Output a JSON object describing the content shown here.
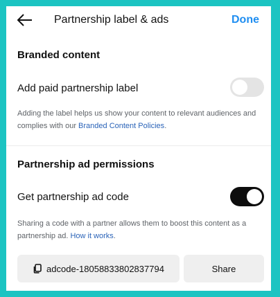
{
  "header": {
    "title": "Partnership label & ads",
    "done_label": "Done"
  },
  "branded": {
    "section_title": "Branded content",
    "toggle_label": "Add paid partnership label",
    "toggle_on": false,
    "help_text": "Adding the label helps us show your content to relevant audiences and complies with our ",
    "help_link": "Branded Content Policies",
    "help_suffix": "."
  },
  "ad_permissions": {
    "section_title": "Partnership ad permissions",
    "toggle_label": "Get partnership ad code",
    "toggle_on": true,
    "help_text": "Sharing a code with a partner allows them to boost this content as a partnership ad. ",
    "help_link": "How it works",
    "help_suffix": "."
  },
  "code_row": {
    "code_value": "adcode-18058833802837794",
    "share_label": "Share"
  },
  "icons": {
    "back": "arrow-left-icon",
    "copy": "copy-icon"
  },
  "colors": {
    "background": "#1cc4c2",
    "accent": "#1f8ef1",
    "link": "#2a63b8",
    "toggle_on": "#0d0d0d",
    "toggle_off": "#e4e4e4"
  }
}
